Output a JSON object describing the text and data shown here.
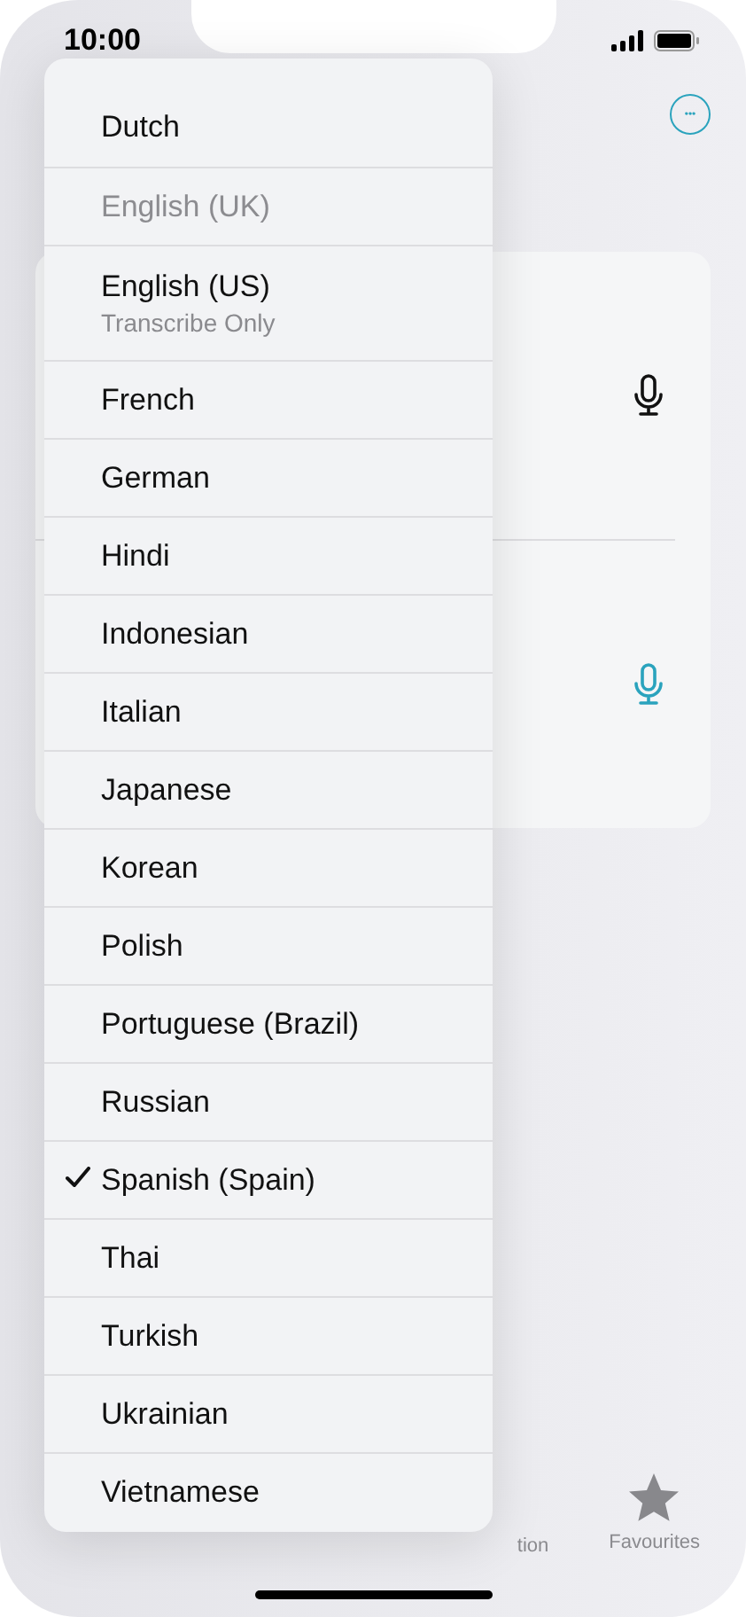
{
  "status_bar": {
    "time": "10:00"
  },
  "more_button": {
    "glyph": "•••"
  },
  "card": {
    "rows": [
      {
        "mic_active": false
      },
      {
        "mic_active": true
      }
    ]
  },
  "tab_bar": [
    {
      "label": "tion",
      "kind": "text",
      "selected": false
    },
    {
      "label": "Favourites",
      "kind": "star",
      "selected": false
    }
  ],
  "language_menu": [
    {
      "label": "Dutch",
      "selected": false,
      "disabled": false
    },
    {
      "label": "English (UK)",
      "selected": false,
      "disabled": true
    },
    {
      "label": "English (US)",
      "subtitle": "Transcribe Only",
      "selected": false,
      "disabled": false
    },
    {
      "label": "French",
      "selected": false,
      "disabled": false
    },
    {
      "label": "German",
      "selected": false,
      "disabled": false
    },
    {
      "label": "Hindi",
      "selected": false,
      "disabled": false
    },
    {
      "label": "Indonesian",
      "selected": false,
      "disabled": false
    },
    {
      "label": "Italian",
      "selected": false,
      "disabled": false
    },
    {
      "label": "Japanese",
      "selected": false,
      "disabled": false
    },
    {
      "label": "Korean",
      "selected": false,
      "disabled": false
    },
    {
      "label": "Polish",
      "selected": false,
      "disabled": false
    },
    {
      "label": "Portuguese (Brazil)",
      "selected": false,
      "disabled": false
    },
    {
      "label": "Russian",
      "selected": false,
      "disabled": false
    },
    {
      "label": "Spanish (Spain)",
      "selected": true,
      "disabled": false
    },
    {
      "label": "Thai",
      "selected": false,
      "disabled": false
    },
    {
      "label": "Turkish",
      "selected": false,
      "disabled": false
    },
    {
      "label": "Ukrainian",
      "selected": false,
      "disabled": false
    },
    {
      "label": "Vietnamese",
      "selected": false,
      "disabled": false
    }
  ]
}
